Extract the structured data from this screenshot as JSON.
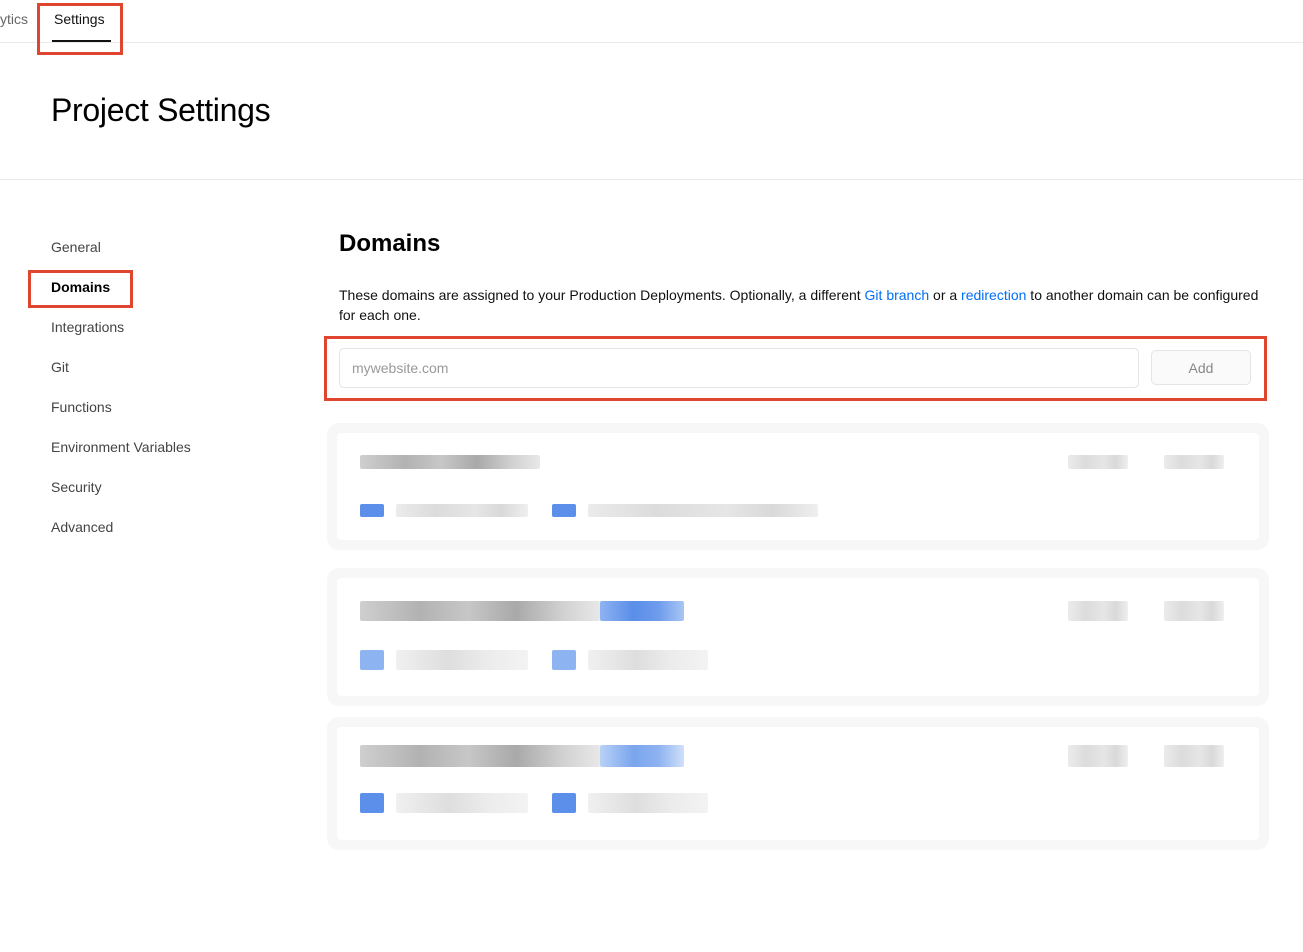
{
  "tabs": {
    "previous_label": "ytics",
    "active_label": "Settings"
  },
  "page": {
    "title": "Project Settings"
  },
  "sidebar": {
    "items": [
      {
        "label": "General"
      },
      {
        "label": "Domains",
        "active": true
      },
      {
        "label": "Integrations"
      },
      {
        "label": "Git"
      },
      {
        "label": "Functions"
      },
      {
        "label": "Environment Variables"
      },
      {
        "label": "Security"
      },
      {
        "label": "Advanced"
      }
    ]
  },
  "domains": {
    "title": "Domains",
    "description_before": "These domains are assigned to your Production Deployments. Optionally, a different ",
    "link_git_branch": "Git branch",
    "description_middle": " or a ",
    "link_redirection": "redirection",
    "description_after": " to another domain can be configured for each one.",
    "input_placeholder": "mywebsite.com",
    "input_value": "",
    "add_label": "Add"
  },
  "colors": {
    "highlight": "#e0452f",
    "link": "#0070f3"
  }
}
